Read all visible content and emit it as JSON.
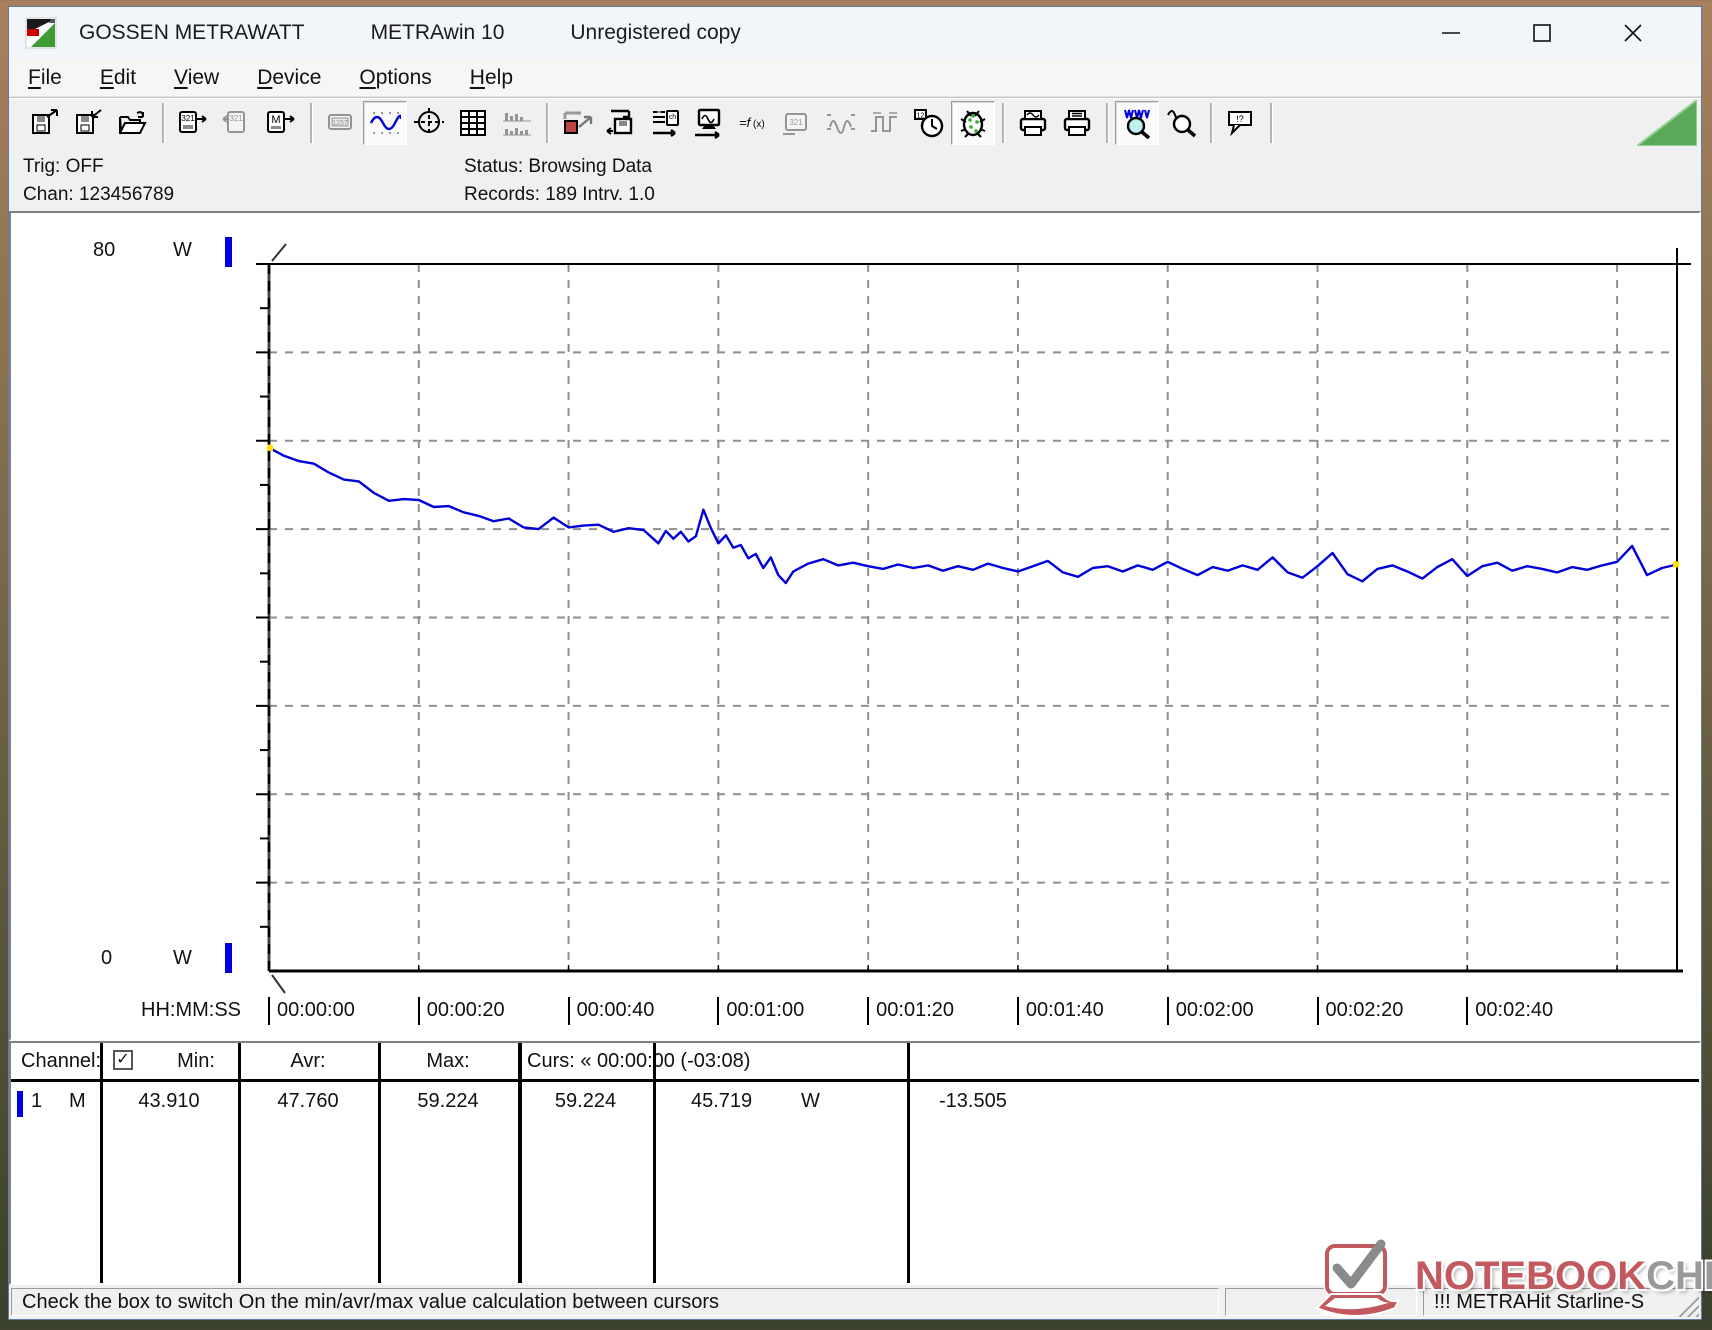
{
  "window": {
    "title_app": "GOSSEN METRAWATT",
    "title_product": "METRAwin 10",
    "title_license": "Unregistered copy",
    "controls": {
      "minimize": "minimize",
      "maximize": "maximize",
      "close": "close"
    }
  },
  "menu": {
    "items": [
      "File",
      "Edit",
      "View",
      "Device",
      "Options",
      "Help"
    ]
  },
  "toolbar": {
    "groups": [
      [
        {
          "name": "save-export-icon"
        },
        {
          "name": "save-import-icon"
        },
        {
          "name": "open-file-icon"
        }
      ],
      [
        {
          "name": "read-device-icon"
        },
        {
          "name": "write-device-icon",
          "disabled": true
        },
        {
          "name": "read-memory-icon"
        }
      ],
      [
        {
          "name": "numeric-display-icon",
          "disabled": true
        },
        {
          "name": "chart-view-icon",
          "active": true
        },
        {
          "name": "scope-view-icon"
        },
        {
          "name": "table-view-icon"
        },
        {
          "name": "histogram-view-icon",
          "disabled": true
        }
      ],
      [
        {
          "name": "device-export-icon"
        },
        {
          "name": "device-store-icon"
        },
        {
          "name": "channel-setup-icon"
        },
        {
          "name": "pc-transfer-icon"
        },
        {
          "name": "formula-icon"
        },
        {
          "name": "display-321-icon",
          "disabled": true
        },
        {
          "name": "analog-signal-icon",
          "disabled": true
        },
        {
          "name": "pulse-signal-icon",
          "disabled": true
        },
        {
          "name": "time-setup-icon"
        },
        {
          "name": "debug-bug-icon",
          "active": true
        }
      ],
      [
        {
          "name": "print-preview-icon"
        },
        {
          "name": "print-icon"
        }
      ],
      [
        {
          "name": "zoom-wave-icon",
          "active": true
        },
        {
          "name": "zoom-select-icon"
        }
      ],
      [
        {
          "name": "annotation-icon"
        }
      ]
    ]
  },
  "info": {
    "trig": "Trig: OFF",
    "chan": "Chan: 123456789",
    "status": "Status:   Browsing Data",
    "records": "Records: 189   Intrv. 1.0"
  },
  "chart_data": {
    "type": "line",
    "xlabel": "HH:MM:SS",
    "ylabel": "W",
    "ylim": [
      0,
      80
    ],
    "xlim_seconds": [
      0,
      188
    ],
    "y_top_label": "80",
    "y_bottom_label": "0",
    "y_unit": "W",
    "grid": {
      "x_step_seconds": 20,
      "y_step": 10,
      "style": "dashed"
    },
    "x_ticks": [
      {
        "t": 0,
        "label": "00:00:00"
      },
      {
        "t": 20,
        "label": "00:00:20"
      },
      {
        "t": 40,
        "label": "00:00:40"
      },
      {
        "t": 60,
        "label": "00:01:00"
      },
      {
        "t": 80,
        "label": "00:01:20"
      },
      {
        "t": 100,
        "label": "00:01:40"
      },
      {
        "t": 120,
        "label": "00:02:00"
      },
      {
        "t": 140,
        "label": "00:02:20"
      },
      {
        "t": 160,
        "label": "00:02:40"
      }
    ],
    "cursor_t": 0,
    "series": [
      {
        "name": "1 M",
        "color": "#0000d8",
        "points": [
          [
            0,
            59.2
          ],
          [
            2,
            58.3
          ],
          [
            4,
            57.7
          ],
          [
            6,
            57.4
          ],
          [
            8,
            56.4
          ],
          [
            10,
            55.6
          ],
          [
            12,
            55.4
          ],
          [
            14,
            54.1
          ],
          [
            16,
            53.2
          ],
          [
            18,
            53.4
          ],
          [
            20,
            53.3
          ],
          [
            22,
            52.5
          ],
          [
            24,
            52.6
          ],
          [
            26,
            51.9
          ],
          [
            28,
            51.5
          ],
          [
            30,
            50.9
          ],
          [
            32,
            51.2
          ],
          [
            34,
            50.2
          ],
          [
            36,
            50.0
          ],
          [
            38,
            51.3
          ],
          [
            40,
            50.2
          ],
          [
            42,
            50.4
          ],
          [
            44,
            50.5
          ],
          [
            46,
            49.7
          ],
          [
            48,
            50.1
          ],
          [
            50,
            49.9
          ],
          [
            52,
            48.4
          ],
          [
            53,
            49.8
          ],
          [
            54,
            48.9
          ],
          [
            55,
            49.7
          ],
          [
            56,
            48.6
          ],
          [
            57,
            49.2
          ],
          [
            58,
            52.2
          ],
          [
            59,
            50.1
          ],
          [
            60,
            48.4
          ],
          [
            61,
            49.3
          ],
          [
            62,
            47.9
          ],
          [
            63,
            48.2
          ],
          [
            64,
            46.7
          ],
          [
            65,
            47.2
          ],
          [
            66,
            45.6
          ],
          [
            67,
            46.8
          ],
          [
            68,
            44.8
          ],
          [
            69,
            43.9
          ],
          [
            70,
            45.2
          ],
          [
            72,
            46.1
          ],
          [
            74,
            46.6
          ],
          [
            76,
            45.9
          ],
          [
            78,
            46.2
          ],
          [
            80,
            45.8
          ],
          [
            82,
            45.5
          ],
          [
            84,
            46.0
          ],
          [
            86,
            45.6
          ],
          [
            88,
            45.9
          ],
          [
            90,
            45.3
          ],
          [
            92,
            45.8
          ],
          [
            94,
            45.4
          ],
          [
            96,
            46.1
          ],
          [
            98,
            45.6
          ],
          [
            100,
            45.2
          ],
          [
            102,
            45.8
          ],
          [
            104,
            46.4
          ],
          [
            106,
            45.1
          ],
          [
            108,
            44.6
          ],
          [
            110,
            45.6
          ],
          [
            112,
            45.8
          ],
          [
            114,
            45.2
          ],
          [
            116,
            45.9
          ],
          [
            118,
            45.4
          ],
          [
            120,
            46.3
          ],
          [
            122,
            45.5
          ],
          [
            124,
            44.8
          ],
          [
            126,
            45.7
          ],
          [
            128,
            45.3
          ],
          [
            130,
            45.9
          ],
          [
            132,
            45.4
          ],
          [
            134,
            46.8
          ],
          [
            136,
            45.1
          ],
          [
            138,
            44.5
          ],
          [
            140,
            45.8
          ],
          [
            142,
            47.3
          ],
          [
            144,
            44.9
          ],
          [
            146,
            44.1
          ],
          [
            148,
            45.5
          ],
          [
            150,
            45.9
          ],
          [
            152,
            45.2
          ],
          [
            154,
            44.4
          ],
          [
            156,
            45.7
          ],
          [
            158,
            46.6
          ],
          [
            160,
            44.7
          ],
          [
            162,
            45.8
          ],
          [
            164,
            46.2
          ],
          [
            166,
            45.3
          ],
          [
            168,
            45.8
          ],
          [
            170,
            45.5
          ],
          [
            172,
            45.1
          ],
          [
            174,
            45.7
          ],
          [
            176,
            45.4
          ],
          [
            178,
            45.9
          ],
          [
            180,
            46.3
          ],
          [
            182,
            48.1
          ],
          [
            184,
            44.8
          ],
          [
            186,
            45.6
          ],
          [
            188,
            46.0
          ]
        ]
      }
    ]
  },
  "table": {
    "header": {
      "channel": "Channel:",
      "checkbox_checked": true,
      "min": "Min:",
      "avr": "Avr:",
      "max": "Max:",
      "curs": "Curs: « 00:00:00 (-03:08)"
    },
    "row": {
      "channel_no": "1",
      "mode": "M",
      "min": "43.910",
      "avr": "47.760",
      "max": "59.224",
      "cursor_value1": "59.224",
      "cursor_value2": "45.719",
      "unit": "W",
      "delta": "-13.505"
    }
  },
  "statusbar": {
    "hint": "Check the box to switch On the min/avr/max value calculation between cursors",
    "device": "!!! METRAHit Starline-S"
  },
  "watermark": {
    "word1": "NOTEBOOK",
    "word2": "CHECK"
  },
  "colors": {
    "series_blue": "#0000d8",
    "channel_marker_blue": "#0000e0",
    "grid_gray": "#8f8f8f",
    "toolbar_triangle_green": "#5aa85a",
    "watermark_red": "#c2595f",
    "watermark_gray": "#9a9a9a",
    "endpoint_yellow": "#ffe400"
  }
}
